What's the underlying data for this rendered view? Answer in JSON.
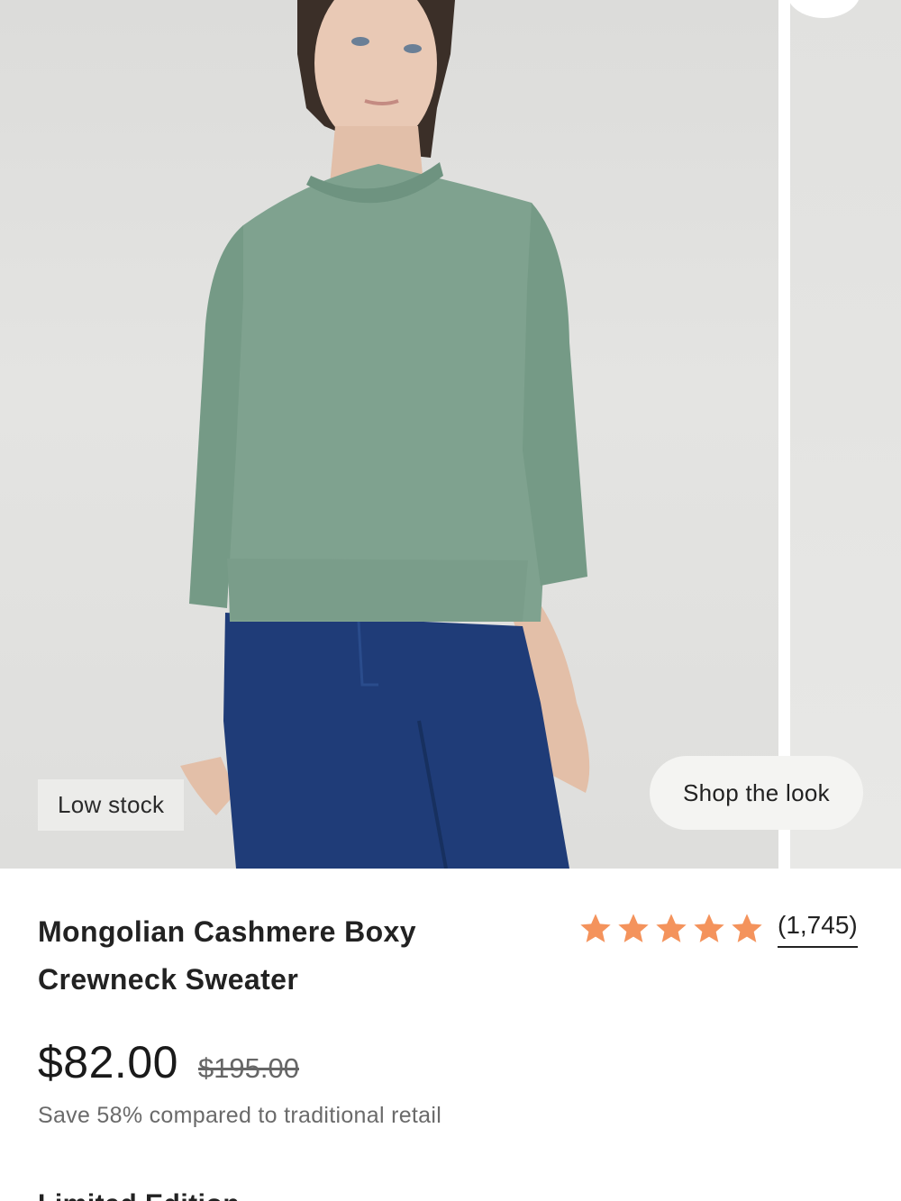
{
  "product_image": {
    "badge": "Low stock",
    "shop_the_look": "Shop the look"
  },
  "product": {
    "title": "Mongolian Cashmere Boxy Crewneck Sweater",
    "rating": {
      "stars": 5,
      "review_count": "(1,745)",
      "star_color": "#f4935c"
    },
    "price": "$82.00",
    "original_price": "$195.00",
    "savings_text": "Save 58% compared to traditional retail",
    "next_section_heading": "Limited Edition"
  }
}
